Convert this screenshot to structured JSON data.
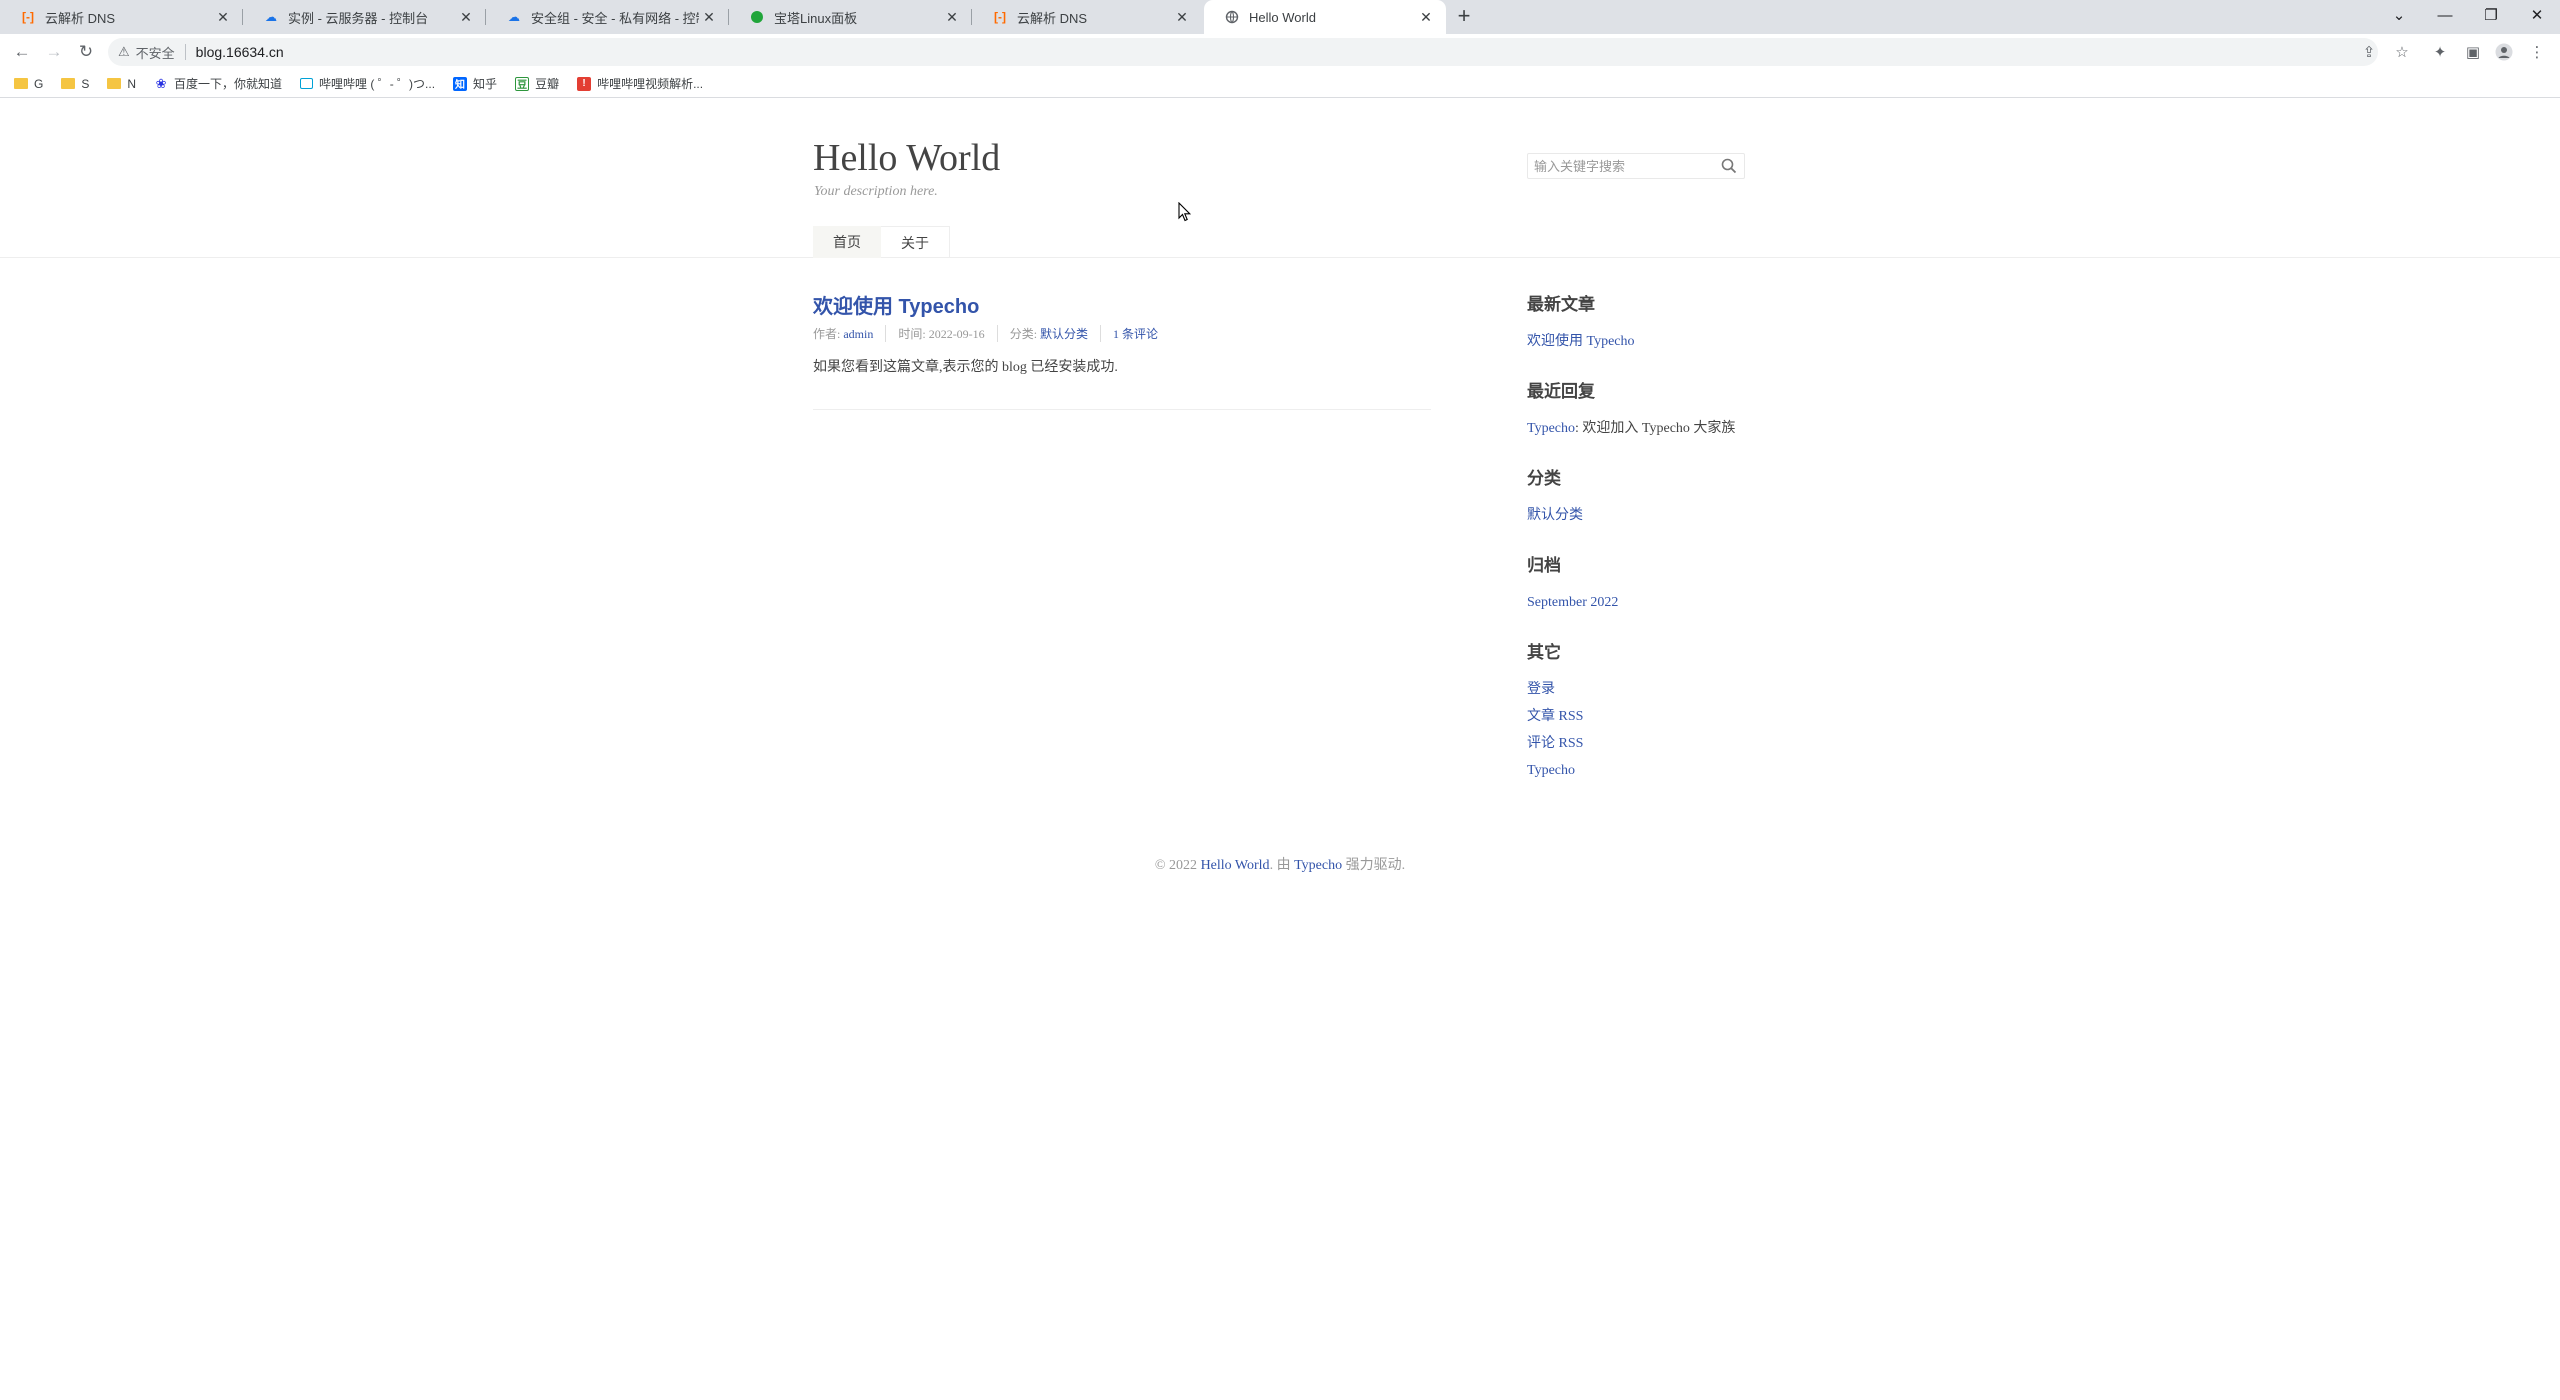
{
  "browser": {
    "tabs": [
      {
        "title": "云解析 DNS",
        "icon": "aliyun-icon",
        "color": "#ff6a00"
      },
      {
        "title": "实例 - 云服务器 - 控制台",
        "icon": "cloud-icon",
        "color": "#1a73e8"
      },
      {
        "title": "安全组 - 安全 - 私有网络 - 控制台",
        "icon": "cloud-icon",
        "color": "#1a73e8"
      },
      {
        "title": "宝塔Linux面板",
        "icon": "baota-icon",
        "color": "#20a53a"
      },
      {
        "title": "云解析 DNS",
        "icon": "aliyun-icon",
        "color": "#ff6a00"
      },
      {
        "title": "Hello World",
        "icon": "globe-icon",
        "color": "#5f6368",
        "active": true
      }
    ],
    "address": {
      "security_label": "不安全",
      "url": "blog.16634.cn"
    },
    "bookmarks": [
      {
        "label": "G",
        "type": "folder"
      },
      {
        "label": "S",
        "type": "folder"
      },
      {
        "label": "N",
        "type": "folder"
      },
      {
        "label": "百度一下，你就知道",
        "type": "baidu"
      },
      {
        "label": "哔哩哔哩 ( ゜- ゜)つ...",
        "type": "bilibili"
      },
      {
        "label": "知乎",
        "type": "zhihu"
      },
      {
        "label": "豆瓣",
        "type": "douban"
      },
      {
        "label": "哔哩哔哩视频解析...",
        "type": "red"
      }
    ]
  },
  "site": {
    "title": "Hello World",
    "description": "Your description here.",
    "search_placeholder": "输入关键字搜索",
    "nav": [
      "首页",
      "关于"
    ]
  },
  "post": {
    "title": "欢迎使用 Typecho",
    "author_label": "作者: ",
    "author": "admin",
    "time_label": "时间: ",
    "time": "2022-09-16",
    "category_label": "分类: ",
    "category": "默认分类",
    "comments": "1 条评论",
    "content": "如果您看到这篇文章,表示您的 blog 已经安装成功."
  },
  "sidebar": {
    "recent_posts_title": "最新文章",
    "recent_posts": [
      "欢迎使用 Typecho"
    ],
    "recent_comments_title": "最近回复",
    "recent_comment_author": "Typecho",
    "recent_comment_text": ": 欢迎加入 Typecho 大家族",
    "categories_title": "分类",
    "categories": [
      "默认分类"
    ],
    "archives_title": "归档",
    "archives": [
      "September 2022"
    ],
    "other_title": "其它",
    "other": [
      "登录",
      "文章 RSS",
      "评论 RSS",
      "Typecho"
    ]
  },
  "footer": {
    "prefix": "© 2022 ",
    "site": "Hello World",
    "middle": ". 由 ",
    "engine": "Typecho",
    "suffix": " 强力驱动."
  },
  "colors": {
    "link": "#3354aa",
    "tabbar": "#dee1e6"
  }
}
